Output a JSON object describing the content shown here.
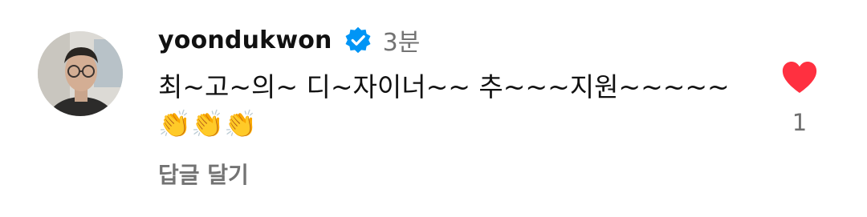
{
  "comment": {
    "username": "yoondukwon",
    "verified_icon": "verified-badge-icon",
    "timestamp": "3분",
    "text": "최~고~의~ 디~자이너~~ 추~~~지원~~~~~\n👏👏👏",
    "reply_label": "답글 달기",
    "like_icon": "heart-icon",
    "like_count": "1"
  },
  "colors": {
    "verified_blue": "#0095f6",
    "heart_red": "#ff3040",
    "text_primary": "#111111",
    "text_secondary": "#737373"
  }
}
